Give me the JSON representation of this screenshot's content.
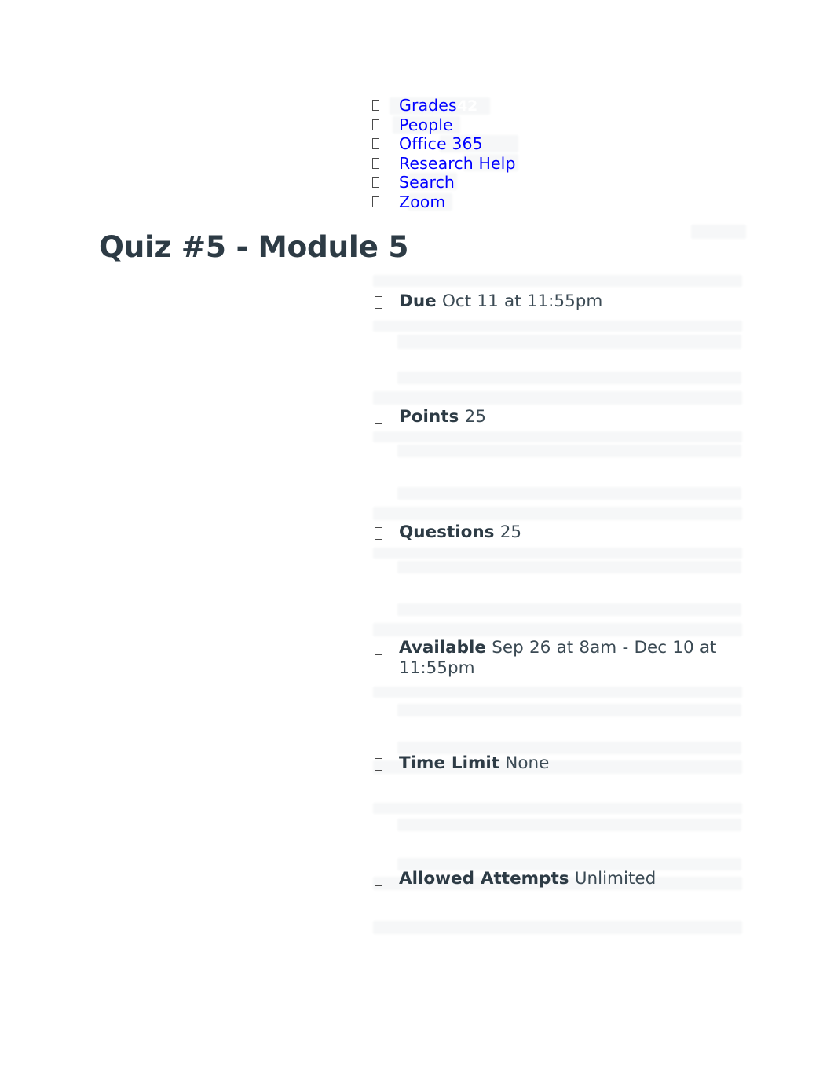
{
  "document": {
    "title": "Quiz #5 - Module 5"
  },
  "nav": {
    "bullet_glyph": "tofu-box",
    "link_color": "#0000ff",
    "items": [
      {
        "label": "Grades",
        "badge": "42"
      },
      {
        "label": "People",
        "badge": ""
      },
      {
        "label": "Office 365",
        "badge": ""
      },
      {
        "label": "Research Help",
        "badge": ""
      },
      {
        "label": "Search",
        "badge": ""
      },
      {
        "label": "Zoom",
        "badge": ""
      }
    ]
  },
  "details": {
    "bullet_glyph": "tofu-box",
    "items": [
      {
        "label": "Due",
        "value": "Oct 11 at 11:55pm"
      },
      {
        "label": "Points",
        "value": "25"
      },
      {
        "label": "Questions",
        "value": "25"
      },
      {
        "label": "Available",
        "value": "Sep 26 at 8am - Dec 10 at 11:55pm"
      },
      {
        "label": "Time Limit",
        "value": "None"
      },
      {
        "label": "Allowed Attempts",
        "value": "Unlimited"
      }
    ]
  },
  "theme": {
    "text_color": "#2d3b45",
    "link_color": "#0000ff",
    "ghost_bar_color": "#f6f7f8",
    "background": "#ffffff"
  }
}
